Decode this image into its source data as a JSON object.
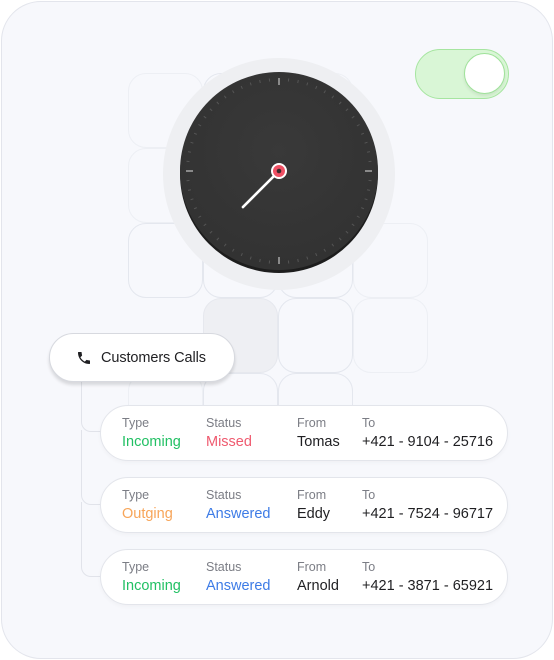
{
  "toggle": {
    "state": "on"
  },
  "clock": {
    "hour_hand_angle_deg": 225,
    "colors": {
      "face": "#363636",
      "center": "#ef5064"
    }
  },
  "category": {
    "icon": "phone-icon",
    "label": "Customers Calls"
  },
  "labels": {
    "type": "Type",
    "status": "Status",
    "from": "From",
    "to": "To"
  },
  "calls": [
    {
      "type": "Incoming",
      "type_color": "#22c064",
      "status": "Missed",
      "status_color": "#ef5a6f",
      "from": "Tomas",
      "to": "+421 - 9104 - 25716"
    },
    {
      "type": "Outging",
      "type_color": "#f7a559",
      "status": "Answered",
      "status_color": "#3d7be6",
      "from": "Eddy",
      "to": "+421 - 7524 - 96717"
    },
    {
      "type": "Incoming",
      "type_color": "#22c064",
      "status": "Answered",
      "status_color": "#3d7be6",
      "from": "Arnold",
      "to": "+421 - 3871 - 65921"
    }
  ]
}
